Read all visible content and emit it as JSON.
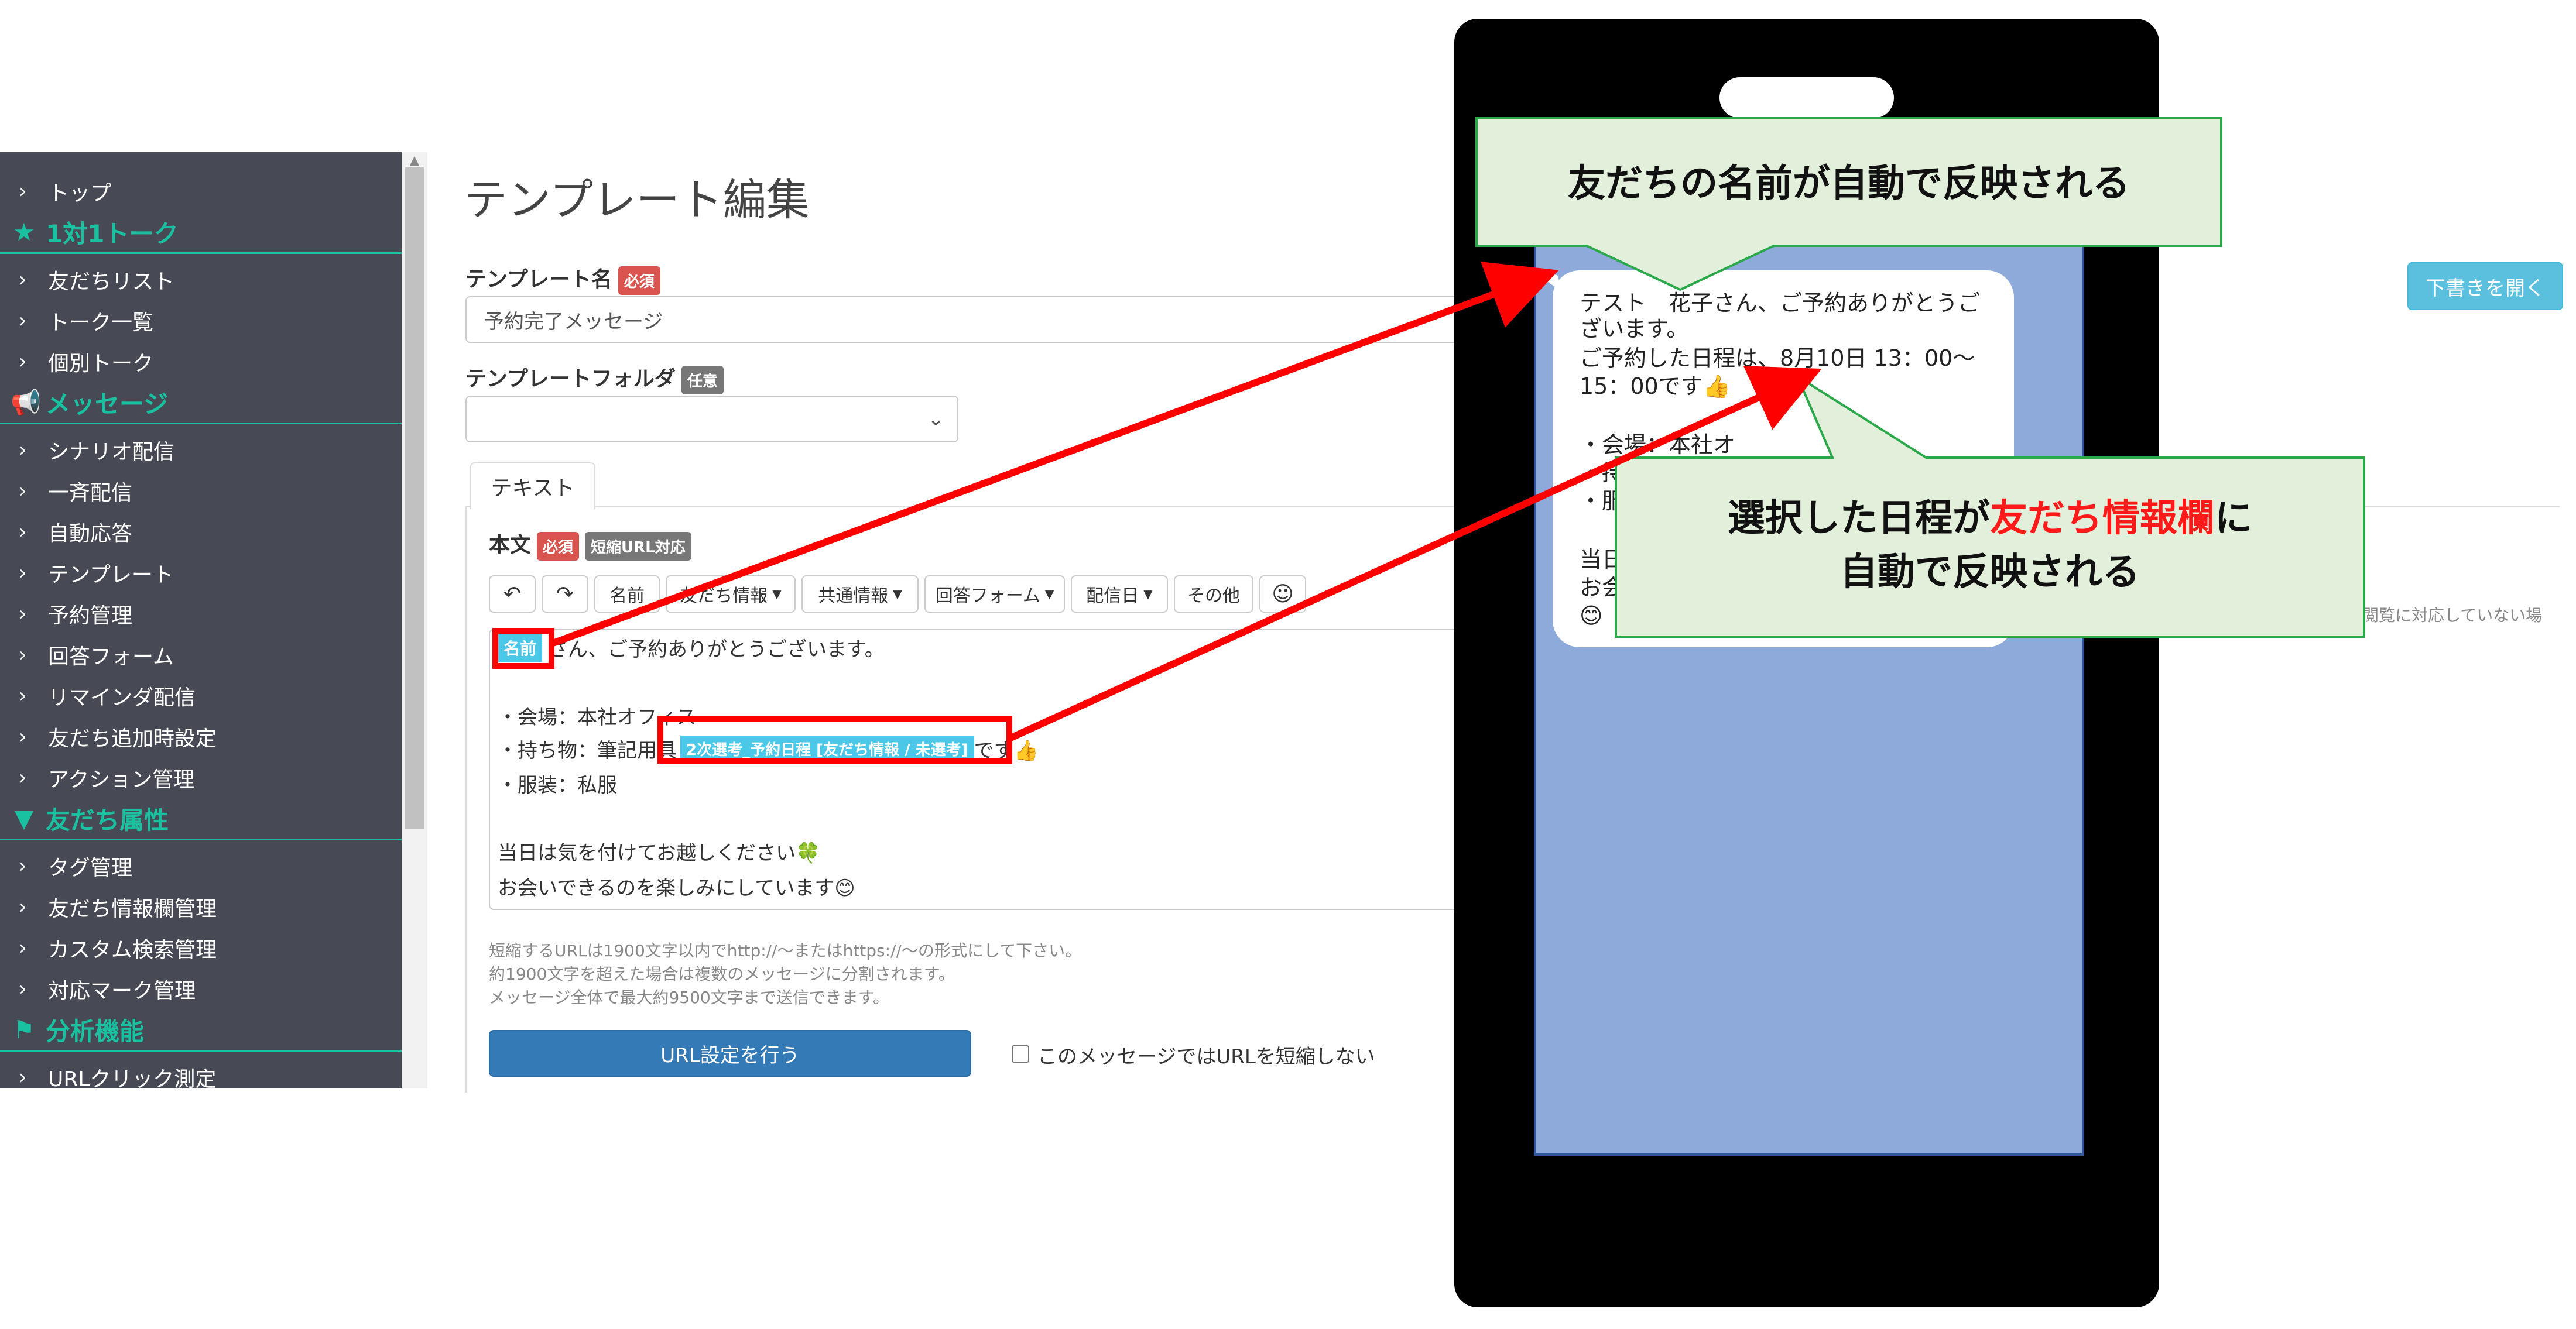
{
  "sidebar": {
    "items_top": [
      {
        "label": "トップ"
      }
    ],
    "sections": [
      {
        "title": "1対1トーク",
        "icon": "star-icon",
        "items": [
          {
            "label": "友だちリスト"
          },
          {
            "label": "トーク一覧"
          },
          {
            "label": "個別トーク"
          }
        ]
      },
      {
        "title": "メッセージ",
        "icon": "megaphone-icon",
        "items": [
          {
            "label": "シナリオ配信"
          },
          {
            "label": "一斉配信"
          },
          {
            "label": "自動応答"
          },
          {
            "label": "テンプレート"
          },
          {
            "label": "予約管理"
          },
          {
            "label": "回答フォーム"
          },
          {
            "label": "リマインダ配信"
          },
          {
            "label": "友だち追加時設定"
          },
          {
            "label": "アクション管理"
          }
        ]
      },
      {
        "title": "友だち属性",
        "icon": "filter-icon",
        "items": [
          {
            "label": "タグ管理"
          },
          {
            "label": "友だち情報欄管理"
          },
          {
            "label": "カスタム検索管理"
          },
          {
            "label": "対応マーク管理"
          }
        ]
      },
      {
        "title": "分析機能",
        "icon": "flag-icon",
        "items": [
          {
            "label": "URLクリック測定"
          }
        ]
      }
    ],
    "accent_color": "#19c1a1"
  },
  "page": {
    "title": "テンプレート編集",
    "template_name_label": "テンプレート名",
    "required_badge": "必須",
    "template_name_value": "予約完了メッセージ",
    "folder_label": "テンプレートフォルダ",
    "optional_badge": "任意",
    "folder_value": "",
    "draft_button": "下書きを開く",
    "tab_text": "テキスト",
    "body_label": "本文",
    "short_url_badge": "短縮URL対応",
    "toolbar": {
      "undo_icon": "undo-icon",
      "redo_icon": "redo-icon",
      "name": "名前",
      "friend_info": "友だち情報",
      "common_info": "共通情報",
      "answer_form": "回答フォーム",
      "delivery_date": "配信日",
      "other": "その他",
      "emoji_icon": "smiley-icon"
    },
    "editor": {
      "name_tag": "名前",
      "line1_suffix": "さん、ご予約ありがとうございます。",
      "line2": "・会場：本社オフィス",
      "line3_prefix": "・持ち物：筆記用具",
      "date_tag": "2次選考_予約日程 [友だち情報 / 未選考]",
      "line3_suffix": "です👍",
      "line4": "・服装：私服",
      "line5": "当日は気を付けてお越しください🍀",
      "line6": "お会いできるのを楽しみにしています😊"
    },
    "notes": [
      "短縮するURLは1900文字以内でhttp://～またはhttps://～の形式にして下さい。",
      "約1900文字を超えた場合は複数のメッセージに分割されます。",
      "メッセージ全体で最大約9500文字まで送信できます。"
    ],
    "url_button": "URL設定を行う",
    "no_shorten_label": "このメッセージではURLを短縮しない",
    "side_note": "閲覧に対応していない場"
  },
  "phone": {
    "msg_lines": [
      "テスト　花子さん、ご予約ありがとうご",
      "ざいます。",
      "ご予約した日程は、8月10日 13：00〜",
      "15：00です👍",
      "",
      "・会場：本社オ",
      "・持",
      "・服",
      "",
      "当日",
      "お会",
      "😊"
    ]
  },
  "callouts": {
    "top": "友だちの名前が自動で反映される",
    "bottom_line1_a": "選択した日程が",
    "bottom_line1_highlight": "友だち情報欄",
    "bottom_line1_b": "に",
    "bottom_line2": "自動で反映される",
    "bg_color": "#e2efda",
    "border_color": "#2aa84a",
    "highlight_color": "#ff1a1a",
    "arrow_color": "#ff0000"
  }
}
